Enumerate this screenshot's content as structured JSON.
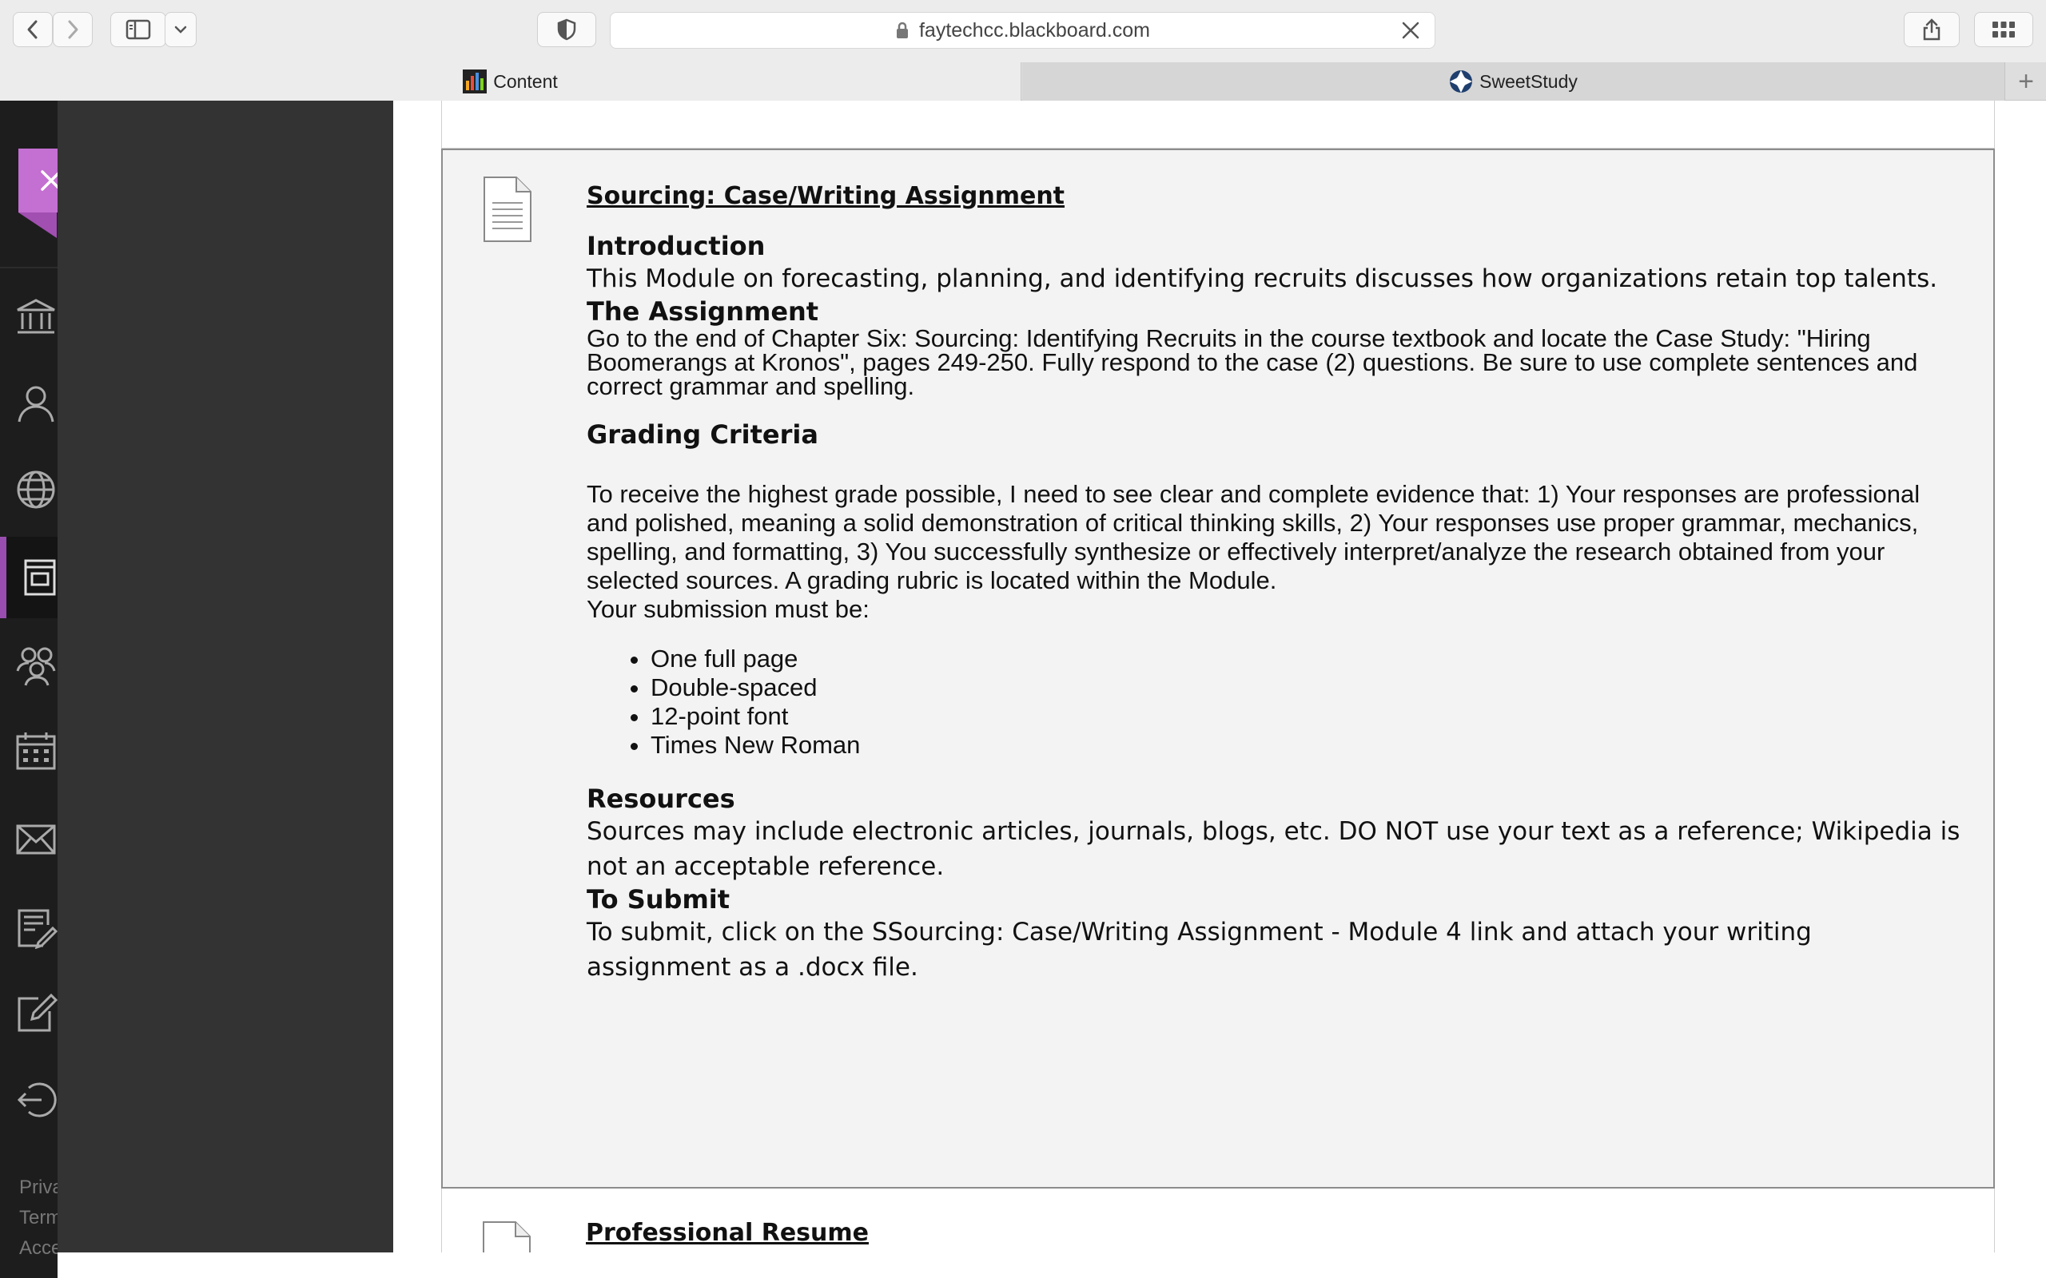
{
  "browser": {
    "url": "faytechcc.blackboard.com",
    "tabs": [
      {
        "label": "Content",
        "active": true
      },
      {
        "label": "SweetStudy",
        "active": false
      }
    ],
    "new_tab_symbol": "+"
  },
  "sidebar": {
    "items": [
      {
        "icon": "institution-icon"
      },
      {
        "icon": "profile-icon"
      },
      {
        "icon": "globe-icon"
      },
      {
        "icon": "courses-icon",
        "active": true
      },
      {
        "icon": "organizations-icon"
      },
      {
        "icon": "calendar-icon"
      },
      {
        "icon": "messages-icon"
      },
      {
        "icon": "grades-icon"
      },
      {
        "icon": "tools-icon"
      },
      {
        "icon": "sign-out-icon"
      }
    ],
    "footer": {
      "privacy": "Privacy",
      "terms": "Terms",
      "accessibility": "Accessibility"
    }
  },
  "assignment": {
    "title": "Sourcing: Case/Writing Assignment",
    "intro_heading": "Introduction",
    "intro_text": "This Module on forecasting, planning, and identifying recruits discusses how organizations retain top talents.",
    "assignment_heading": "The Assignment",
    "assignment_text": "Go to the end of Chapter Six: Sourcing: Identifying Recruits in the course textbook and locate the Case Study: \"Hiring Boomerangs at Kronos\", pages 249-250.  Fully respond to the case (2) questions. Be sure to use complete sentences and correct grammar and spelling.",
    "grading_heading": "Grading Criteria",
    "grading_text": "To receive the highest grade possible, I need to see clear and complete evidence that: 1) Your responses are professional and polished, meaning a solid demonstration of critical thinking skills, 2) Your responses use proper grammar, mechanics, spelling, and formatting, 3) You successfully synthesize or effectively interpret/analyze the research obtained from your selected sources. A grading rubric is located within the Module.",
    "submission_intro": "Your submission must be:",
    "requirements": [
      "One full page",
      "Double-spaced",
      "12-point font",
      "Times New Roman"
    ],
    "resources_heading": "Resources",
    "resources_text": "Sources may include electronic articles, journals, blogs, etc. DO NOT use your text as a reference; Wikipedia is not an acceptable reference.",
    "submit_heading": "To Submit",
    "submit_text": "To submit, click on the SSourcing: Case/Writing Assignment - Module 4 link and attach your writing assignment as a .docx file."
  },
  "next_item": {
    "title": "Professional Resume"
  }
}
